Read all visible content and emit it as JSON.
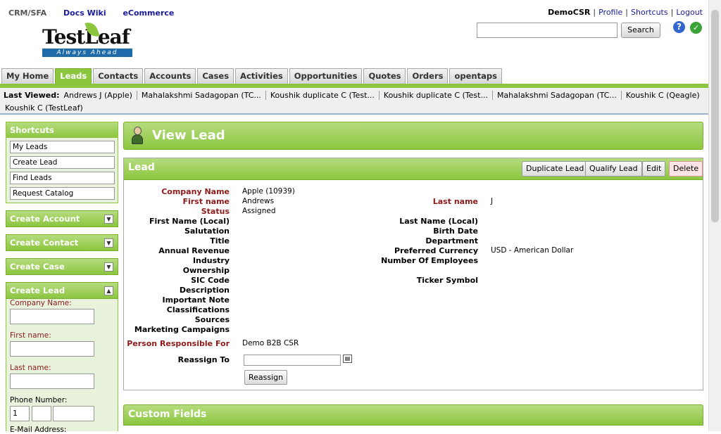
{
  "top_links": [
    "CRM/SFA",
    "Docs Wiki",
    "eCommerce"
  ],
  "logo": {
    "text": "TestLeaf",
    "tagline": "Always Ahead"
  },
  "user_bar": {
    "user": "DemoCSR",
    "profile": "Profile",
    "shortcuts": "Shortcuts",
    "logout": "Logout"
  },
  "search": {
    "button": "Search",
    "value": ""
  },
  "tabs": [
    "My Home",
    "Leads",
    "Contacts",
    "Accounts",
    "Cases",
    "Activities",
    "Opportunities",
    "Quotes",
    "Orders",
    "opentaps"
  ],
  "active_tab": "Leads",
  "last_viewed": {
    "label": "Last Viewed:",
    "items": [
      "Andrews J (Apple)",
      "Mahalakshmi Sadagopan (TC...",
      "Koushik duplicate C (Test...",
      "Koushik duplicate C (Test...",
      "Mahalakshmi Sadagopan (TC...",
      "Koushik C (Qeagle)"
    ],
    "wrap_item": "Koushik C (TestLeaf)"
  },
  "sidebar": {
    "shortcuts_title": "Shortcuts",
    "shortcuts": [
      "My Leads",
      "Create Lead",
      "Find Leads",
      "Request Catalog"
    ],
    "sections": [
      "Create Account",
      "Create Contact",
      "Create Case",
      "Create Lead"
    ],
    "create_lead": {
      "company_label": "Company Name:",
      "first_label": "First name:",
      "last_label": "Last name:",
      "phone_label": "Phone Number:",
      "phone_country": "1",
      "email_label": "E-Mail Address:"
    }
  },
  "page_title": "View Lead",
  "lead_panel": {
    "title": "Lead",
    "buttons": {
      "duplicate": "Duplicate Lead",
      "qualify": "Qualify Lead",
      "edit": "Edit",
      "delete": "Delete"
    },
    "fields_left": [
      {
        "label": "Company Name",
        "value": "Apple (10939)"
      },
      {
        "label": "First name",
        "value": "Andrews"
      },
      {
        "label": "Status",
        "value": "Assigned"
      },
      {
        "label": "First Name (Local)",
        "value": ""
      },
      {
        "label": "Salutation",
        "value": ""
      },
      {
        "label": "Title",
        "value": ""
      },
      {
        "label": "Annual Revenue",
        "value": ""
      },
      {
        "label": "Industry",
        "value": ""
      },
      {
        "label": "Ownership",
        "value": ""
      },
      {
        "label": "SIC Code",
        "value": ""
      },
      {
        "label": "Description",
        "value": ""
      },
      {
        "label": "Important Note",
        "value": ""
      },
      {
        "label": "Classifications",
        "value": ""
      },
      {
        "label": "Sources",
        "value": ""
      },
      {
        "label": "Marketing Campaigns",
        "value": ""
      }
    ],
    "fields_right": [
      {
        "label": "Last name",
        "value": "J"
      },
      {
        "label": "Last Name (Local)",
        "value": ""
      },
      {
        "label": "Birth Date",
        "value": ""
      },
      {
        "label": "Department",
        "value": ""
      },
      {
        "label": "Preferred Currency",
        "value": "USD - American Dollar"
      },
      {
        "label": "Number Of Employees",
        "value": ""
      },
      {
        "label": "Ticker Symbol",
        "value": ""
      }
    ],
    "person_responsible_label": "Person Responsible For",
    "person_responsible_value": "Demo B2B CSR",
    "reassign_label": "Reassign To",
    "reassign_button": "Reassign"
  },
  "custom_fields_title": "Custom Fields",
  "colors": {
    "accent_green": "#8cc63f",
    "required_red": "#8b1a1a",
    "link_blue": "#1a1a9a"
  }
}
